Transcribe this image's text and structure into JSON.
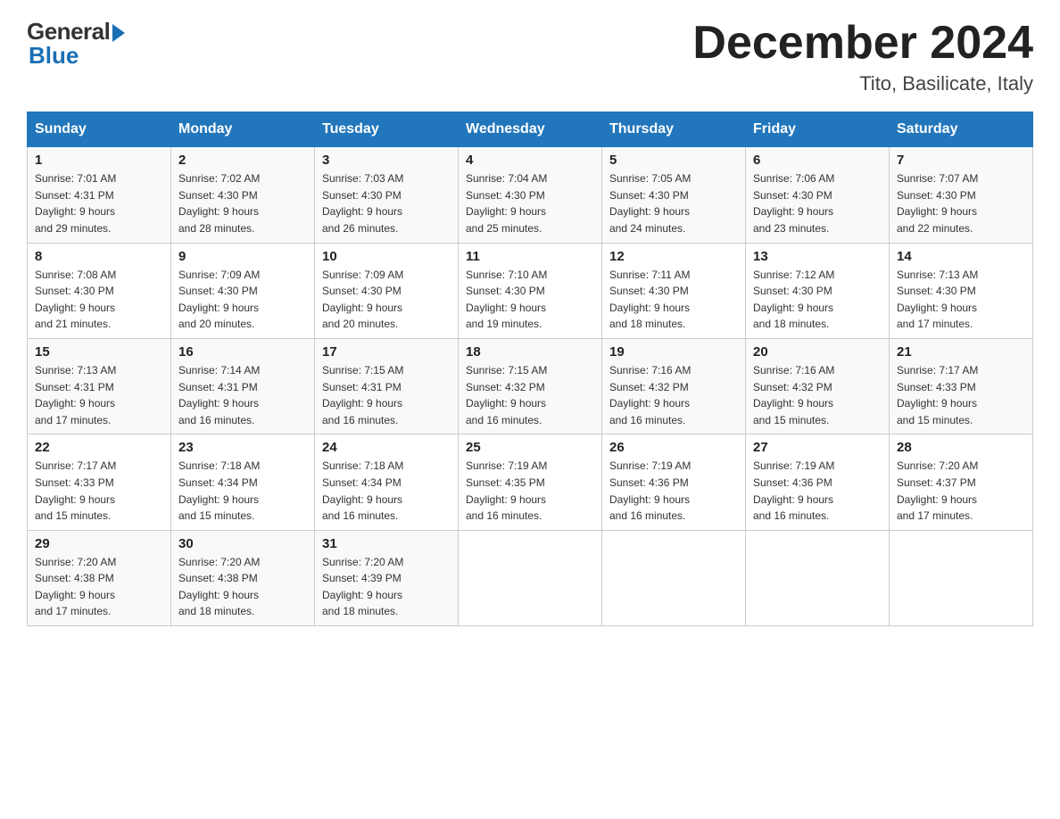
{
  "header": {
    "logo_general": "General",
    "logo_blue": "Blue",
    "month_title": "December 2024",
    "location": "Tito, Basilicate, Italy"
  },
  "days_of_week": [
    "Sunday",
    "Monday",
    "Tuesday",
    "Wednesday",
    "Thursday",
    "Friday",
    "Saturday"
  ],
  "weeks": [
    [
      {
        "num": "1",
        "sunrise": "7:01 AM",
        "sunset": "4:31 PM",
        "daylight": "9 hours and 29 minutes."
      },
      {
        "num": "2",
        "sunrise": "7:02 AM",
        "sunset": "4:30 PM",
        "daylight": "9 hours and 28 minutes."
      },
      {
        "num": "3",
        "sunrise": "7:03 AM",
        "sunset": "4:30 PM",
        "daylight": "9 hours and 26 minutes."
      },
      {
        "num": "4",
        "sunrise": "7:04 AM",
        "sunset": "4:30 PM",
        "daylight": "9 hours and 25 minutes."
      },
      {
        "num": "5",
        "sunrise": "7:05 AM",
        "sunset": "4:30 PM",
        "daylight": "9 hours and 24 minutes."
      },
      {
        "num": "6",
        "sunrise": "7:06 AM",
        "sunset": "4:30 PM",
        "daylight": "9 hours and 23 minutes."
      },
      {
        "num": "7",
        "sunrise": "7:07 AM",
        "sunset": "4:30 PM",
        "daylight": "9 hours and 22 minutes."
      }
    ],
    [
      {
        "num": "8",
        "sunrise": "7:08 AM",
        "sunset": "4:30 PM",
        "daylight": "9 hours and 21 minutes."
      },
      {
        "num": "9",
        "sunrise": "7:09 AM",
        "sunset": "4:30 PM",
        "daylight": "9 hours and 20 minutes."
      },
      {
        "num": "10",
        "sunrise": "7:09 AM",
        "sunset": "4:30 PM",
        "daylight": "9 hours and 20 minutes."
      },
      {
        "num": "11",
        "sunrise": "7:10 AM",
        "sunset": "4:30 PM",
        "daylight": "9 hours and 19 minutes."
      },
      {
        "num": "12",
        "sunrise": "7:11 AM",
        "sunset": "4:30 PM",
        "daylight": "9 hours and 18 minutes."
      },
      {
        "num": "13",
        "sunrise": "7:12 AM",
        "sunset": "4:30 PM",
        "daylight": "9 hours and 18 minutes."
      },
      {
        "num": "14",
        "sunrise": "7:13 AM",
        "sunset": "4:30 PM",
        "daylight": "9 hours and 17 minutes."
      }
    ],
    [
      {
        "num": "15",
        "sunrise": "7:13 AM",
        "sunset": "4:31 PM",
        "daylight": "9 hours and 17 minutes."
      },
      {
        "num": "16",
        "sunrise": "7:14 AM",
        "sunset": "4:31 PM",
        "daylight": "9 hours and 16 minutes."
      },
      {
        "num": "17",
        "sunrise": "7:15 AM",
        "sunset": "4:31 PM",
        "daylight": "9 hours and 16 minutes."
      },
      {
        "num": "18",
        "sunrise": "7:15 AM",
        "sunset": "4:32 PM",
        "daylight": "9 hours and 16 minutes."
      },
      {
        "num": "19",
        "sunrise": "7:16 AM",
        "sunset": "4:32 PM",
        "daylight": "9 hours and 16 minutes."
      },
      {
        "num": "20",
        "sunrise": "7:16 AM",
        "sunset": "4:32 PM",
        "daylight": "9 hours and 15 minutes."
      },
      {
        "num": "21",
        "sunrise": "7:17 AM",
        "sunset": "4:33 PM",
        "daylight": "9 hours and 15 minutes."
      }
    ],
    [
      {
        "num": "22",
        "sunrise": "7:17 AM",
        "sunset": "4:33 PM",
        "daylight": "9 hours and 15 minutes."
      },
      {
        "num": "23",
        "sunrise": "7:18 AM",
        "sunset": "4:34 PM",
        "daylight": "9 hours and 15 minutes."
      },
      {
        "num": "24",
        "sunrise": "7:18 AM",
        "sunset": "4:34 PM",
        "daylight": "9 hours and 16 minutes."
      },
      {
        "num": "25",
        "sunrise": "7:19 AM",
        "sunset": "4:35 PM",
        "daylight": "9 hours and 16 minutes."
      },
      {
        "num": "26",
        "sunrise": "7:19 AM",
        "sunset": "4:36 PM",
        "daylight": "9 hours and 16 minutes."
      },
      {
        "num": "27",
        "sunrise": "7:19 AM",
        "sunset": "4:36 PM",
        "daylight": "9 hours and 16 minutes."
      },
      {
        "num": "28",
        "sunrise": "7:20 AM",
        "sunset": "4:37 PM",
        "daylight": "9 hours and 17 minutes."
      }
    ],
    [
      {
        "num": "29",
        "sunrise": "7:20 AM",
        "sunset": "4:38 PM",
        "daylight": "9 hours and 17 minutes."
      },
      {
        "num": "30",
        "sunrise": "7:20 AM",
        "sunset": "4:38 PM",
        "daylight": "9 hours and 18 minutes."
      },
      {
        "num": "31",
        "sunrise": "7:20 AM",
        "sunset": "4:39 PM",
        "daylight": "9 hours and 18 minutes."
      },
      null,
      null,
      null,
      null
    ]
  ],
  "labels": {
    "sunrise": "Sunrise:",
    "sunset": "Sunset:",
    "daylight": "Daylight:"
  }
}
